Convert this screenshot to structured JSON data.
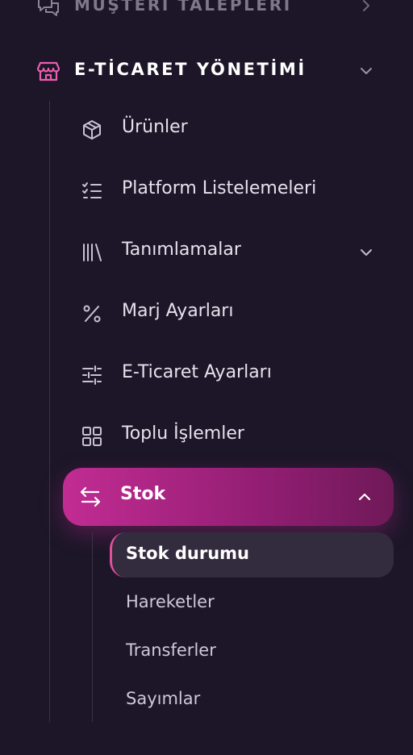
{
  "sidebar": {
    "prev_section": {
      "label": "MÜŞTERİ TALEPLERİ",
      "icon": "chat-bubbles-icon",
      "chevron": "chevron-right-icon"
    },
    "section": {
      "label": "E-TİCARET YÖNETİMİ",
      "icon": "store-icon",
      "chevron": "chevron-down-icon",
      "accent_color": "#ec5fb0"
    },
    "items": [
      {
        "label": "Ürünler",
        "icon": "cube-icon"
      },
      {
        "label": "Platform Listelemeleri",
        "icon": "checklist-icon"
      },
      {
        "label": "Tanımlamalar",
        "icon": "library-icon",
        "chevron": "chevron-down-icon"
      },
      {
        "label": "Marj Ayarları",
        "icon": "percent-icon"
      },
      {
        "label": "E-Ticaret Ayarları",
        "icon": "sliders-icon"
      },
      {
        "label": "Toplu İşlemler",
        "icon": "grid-icon"
      },
      {
        "label": "Stok",
        "icon": "swap-arrows-icon",
        "chevron": "chevron-up-icon",
        "active": true
      }
    ],
    "sub_items": [
      {
        "label": "Stok durumu",
        "active": true
      },
      {
        "label": "Hareketler"
      },
      {
        "label": "Transferler"
      },
      {
        "label": "Sayımlar"
      }
    ],
    "active_gradient": [
      "#c22c93",
      "#6f1958"
    ]
  }
}
